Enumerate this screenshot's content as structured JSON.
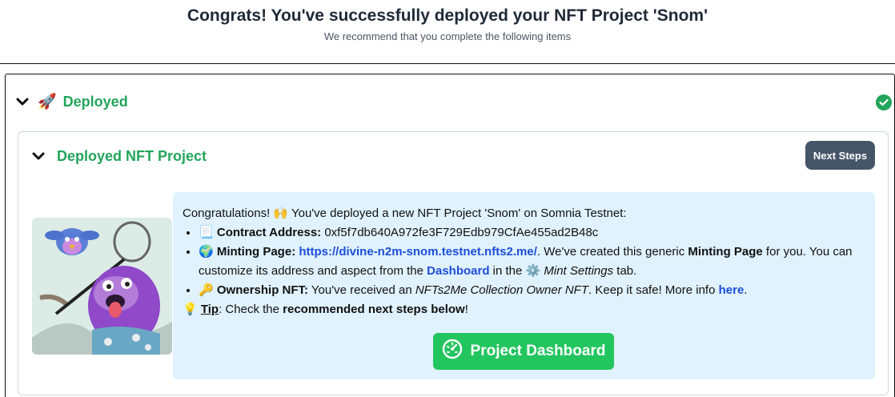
{
  "header": {
    "title": "Congrats! You've successfully deployed your NFT Project 'Snom'",
    "subtitle": "We recommend that you complete the following items"
  },
  "section": {
    "emoji": "🚀",
    "title": "Deployed",
    "status_icon": "check-circle-icon"
  },
  "subsection": {
    "title": "Deployed NFT Project",
    "next_steps_label": "Next Steps"
  },
  "info": {
    "intro_a": "Congratulations! ",
    "intro_emoji": "🙌",
    "intro_b": " You've deployed a new NFT Project 'Snom' on Somnia Testnet:",
    "contract_emoji": "📃",
    "contract_label": "Contract Address:",
    "contract_value": "0xf5f7db640A972fe3F729Edb979CfAe455ad2B48c",
    "minting_emoji": "🌍",
    "minting_label": "Minting Page:",
    "minting_url": "https://divine-n2m-snom.testnet.nfts2.me/",
    "minting_text_a": ". We've created this generic ",
    "minting_bold": "Minting Page",
    "minting_text_b": " for you. You can customize its address and aspect from the ",
    "dashboard_link": "Dashboard",
    "minting_text_c": " in the ",
    "settings_emoji": "⚙️",
    "settings_tab": "Mint Settings",
    "minting_text_d": " tab.",
    "ownership_emoji": "🔑",
    "ownership_label": "Ownership NFT:",
    "ownership_text_a": " You've received an ",
    "ownership_italic": "NFTs2Me Collection Owner NFT",
    "ownership_text_b": ". Keep it safe! More info ",
    "here_link": "here",
    "ownership_text_c": ".",
    "tip_emoji": "💡",
    "tip_label": "Tip",
    "tip_text_a": ": Check the ",
    "tip_bold": "recommended next steps below",
    "tip_text_b": "!"
  },
  "dashboard_button": {
    "label": "Project Dashboard",
    "icon": "gauge-icon"
  },
  "colors": {
    "success": "#22a55b",
    "button_green": "#22c55e",
    "info_bg": "#e0f2fe",
    "link": "#1d4ed8",
    "slate_button": "#475569"
  }
}
